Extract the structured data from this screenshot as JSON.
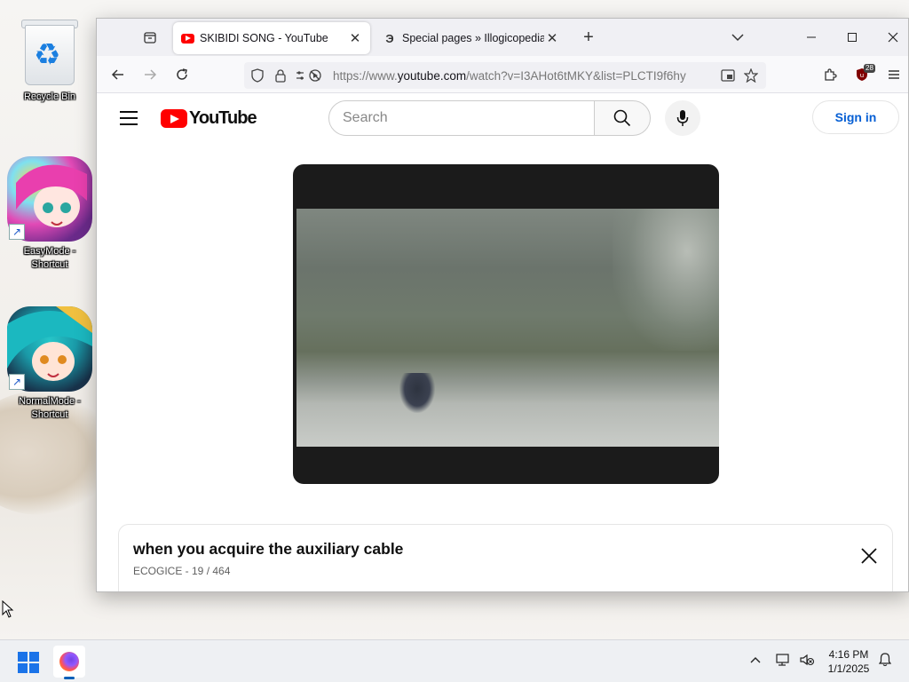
{
  "desktop": {
    "icons": [
      {
        "label": "Recycle Bin"
      },
      {
        "label": "EasyMode - Shortcut"
      },
      {
        "label": "NormalMode - Shortcut"
      }
    ]
  },
  "browser": {
    "tabs": [
      {
        "title": "SKIBIDI SONG - YouTube",
        "active": true
      },
      {
        "title": "Special pages » Illogicopedia - T",
        "active": false
      }
    ],
    "url_prefix": "https://www.",
    "url_domain": "youtube.com",
    "url_rest": "/watch?v=I3AHot6tMKY&list=PLCTI9f6hy",
    "extension_badge": "28"
  },
  "youtube": {
    "logo_text": "YouTube",
    "search_placeholder": "Search",
    "signin_label": "Sign in",
    "playlist_card": {
      "title": "when you acquire the auxiliary cable",
      "subtitle": "ECOGICE - 19 / 464"
    }
  },
  "taskbar": {
    "time": "4:16 PM",
    "date": "1/1/2025"
  },
  "colors": {
    "youtube_red": "#ff0000",
    "signin_blue": "#065fd4",
    "windows_blue": "#1a73e8"
  }
}
